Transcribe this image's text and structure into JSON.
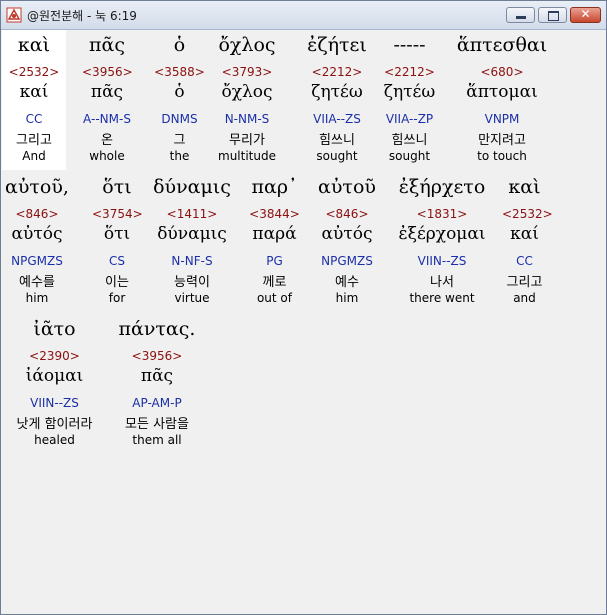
{
  "window": {
    "title": "@원전분해 - 눅 6:19",
    "minimize_label": "minimize",
    "maximize_label": "maximize",
    "close_label": "✕"
  },
  "words": [
    {
      "greek": "καὶ",
      "strongs": "<2532>",
      "lemma": "καί",
      "morph": "CC",
      "korean": "그리고",
      "english": "And",
      "selected": true
    },
    {
      "greek": "πᾶς",
      "strongs": "<3956>",
      "lemma": "πᾶς",
      "morph": "A--NM-S",
      "korean": "온",
      "english": "whole"
    },
    {
      "greek": "ὁ",
      "strongs": "<3588>",
      "lemma": "ὁ",
      "morph": "DNMS",
      "korean": "그",
      "english": "the"
    },
    {
      "greek": "ὄχλος",
      "strongs": "<3793>",
      "lemma": "ὄχλος",
      "morph": "N-NM-S",
      "korean": "무리가",
      "english": "multitude"
    },
    {
      "greek": "ἐζήτει",
      "strongs": "<2212>",
      "lemma": "ζητέω",
      "morph": "VIIA--ZS",
      "korean": "힘쓰니",
      "english": "sought"
    },
    {
      "greek": "-----",
      "strongs": "<2212>",
      "lemma": "ζητέω",
      "morph": "VIIA--ZP",
      "korean": "힘쓰니",
      "english": "sought"
    },
    {
      "greek": "ἅπτεσθαι",
      "strongs": "<680>",
      "lemma": "ἅπτομαι",
      "morph": "VNPM",
      "korean": "만지려고",
      "english": "to touch"
    },
    {
      "greek": "αὐτοῦ,",
      "strongs": "<846>",
      "lemma": "αὐτός",
      "morph": "NPGMZS",
      "korean": "예수를",
      "english": "him"
    },
    {
      "greek": "ὅτι",
      "strongs": "<3754>",
      "lemma": "ὅτι",
      "morph": "CS",
      "korean": "이는",
      "english": "for"
    },
    {
      "greek": "δύναμις",
      "strongs": "<1411>",
      "lemma": "δύναμις",
      "morph": "N-NF-S",
      "korean": "능력이",
      "english": "virtue"
    },
    {
      "greek": "παρ᾽",
      "strongs": "<3844>",
      "lemma": "παρά",
      "morph": "PG",
      "korean": "께로",
      "english": "out of"
    },
    {
      "greek": "αὐτοῦ",
      "strongs": "<846>",
      "lemma": "αὐτός",
      "morph": "NPGMZS",
      "korean": "예수",
      "english": "him"
    },
    {
      "greek": "ἐξήρχετο",
      "strongs": "<1831>",
      "lemma": "ἐξέρχομαι",
      "morph": "VIIN--ZS",
      "korean": "나서",
      "english": "there went"
    },
    {
      "greek": "καὶ",
      "strongs": "<2532>",
      "lemma": "καί",
      "morph": "CC",
      "korean": "그리고",
      "english": "and"
    },
    {
      "greek": "ἰᾶτο",
      "strongs": "<2390>",
      "lemma": "ἰάομαι",
      "morph": "VIIN--ZS",
      "korean": "낫게 함이러라",
      "english": "healed"
    },
    {
      "greek": "πάντας.",
      "strongs": "<3956>",
      "lemma": "πᾶς",
      "morph": "AP-AM-P",
      "korean": "모든 사람을",
      "english": "them all"
    }
  ]
}
